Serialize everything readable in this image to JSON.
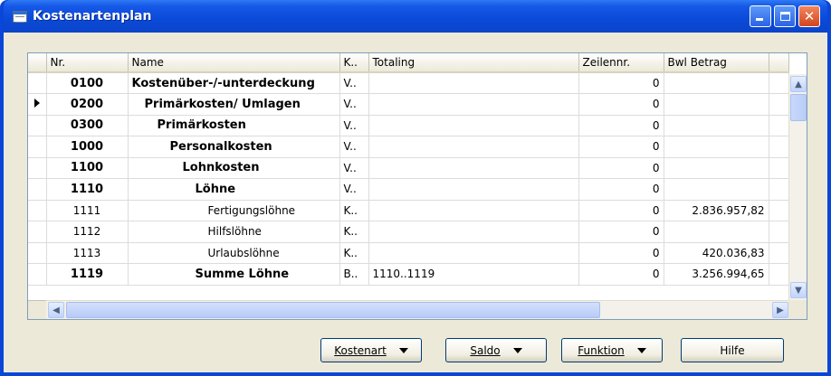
{
  "window": {
    "title": "Kostenartenplan"
  },
  "grid": {
    "columns": [
      "Nr.",
      "Name",
      "K..",
      "Totaling",
      "Zeilennr.",
      "Bwl Betrag"
    ],
    "rows": [
      {
        "nr": "0100",
        "name": "Kostenüber-/-unterdeckung",
        "k": "V..",
        "totaling": "",
        "zeilennr": "0",
        "betrag": "",
        "bold": true,
        "indent": 0
      },
      {
        "nr": "0200",
        "name": "Primärkosten/ Umlagen",
        "k": "V..",
        "totaling": "",
        "zeilennr": "0",
        "betrag": "",
        "bold": true,
        "indent": 1,
        "current": true
      },
      {
        "nr": "0300",
        "name": "Primärkosten",
        "k": "V..",
        "totaling": "",
        "zeilennr": "0",
        "betrag": "",
        "bold": true,
        "indent": 2
      },
      {
        "nr": "1000",
        "name": "Personalkosten",
        "k": "V..",
        "totaling": "",
        "zeilennr": "0",
        "betrag": "",
        "bold": true,
        "indent": 3
      },
      {
        "nr": "1100",
        "name": "Lohnkosten",
        "k": "V..",
        "totaling": "",
        "zeilennr": "0",
        "betrag": "",
        "bold": true,
        "indent": 4
      },
      {
        "nr": "1110",
        "name": "Löhne",
        "k": "V..",
        "totaling": "",
        "zeilennr": "0",
        "betrag": "",
        "bold": true,
        "indent": 5
      },
      {
        "nr": "1111",
        "name": "Fertigungslöhne",
        "k": "K..",
        "totaling": "",
        "zeilennr": "0",
        "betrag": "2.836.957,82",
        "bold": false,
        "indent": 6
      },
      {
        "nr": "1112",
        "name": "Hilfslöhne",
        "k": "K..",
        "totaling": "",
        "zeilennr": "0",
        "betrag": "",
        "bold": false,
        "indent": 6
      },
      {
        "nr": "1113",
        "name": "Urlaubslöhne",
        "k": "K..",
        "totaling": "",
        "zeilennr": "0",
        "betrag": "420.036,83",
        "bold": false,
        "indent": 6
      },
      {
        "nr": "1119",
        "name": "Summe Löhne",
        "k": "B..",
        "totaling": "1110..1119",
        "zeilennr": "0",
        "betrag": "3.256.994,65",
        "bold": true,
        "indent": 5
      }
    ]
  },
  "buttons": {
    "kostenart": "Kostenart",
    "saldo": "Saldo",
    "funktion": "Funktion",
    "hilfe": "Hilfe"
  },
  "colors": {
    "titlebar": "#0a4ad8",
    "client": "#ece9d8",
    "close_button": "#d3451b"
  }
}
